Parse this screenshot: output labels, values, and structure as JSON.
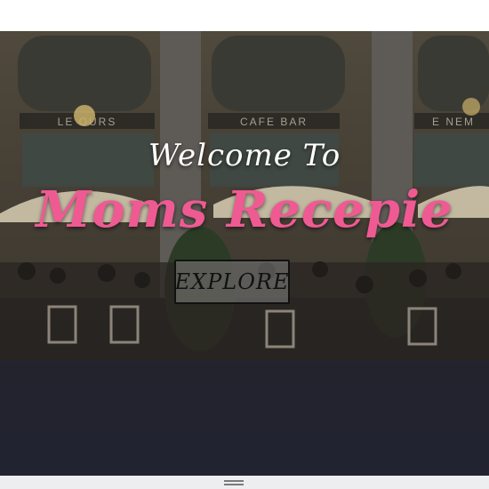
{
  "hero": {
    "welcome_text": "Welcome To",
    "brand_name": "Moms Recepie",
    "cta_label": "EXPLORE",
    "storefront_signs": [
      "LE  OURS",
      "CAFE  BAR",
      "E NEM"
    ]
  },
  "colors": {
    "brand_pink": "#ef5a93",
    "welcome_white": "#ffffff",
    "cta_border": "#111111"
  },
  "footer": {
    "handle_icon": "drag-handle-icon"
  }
}
